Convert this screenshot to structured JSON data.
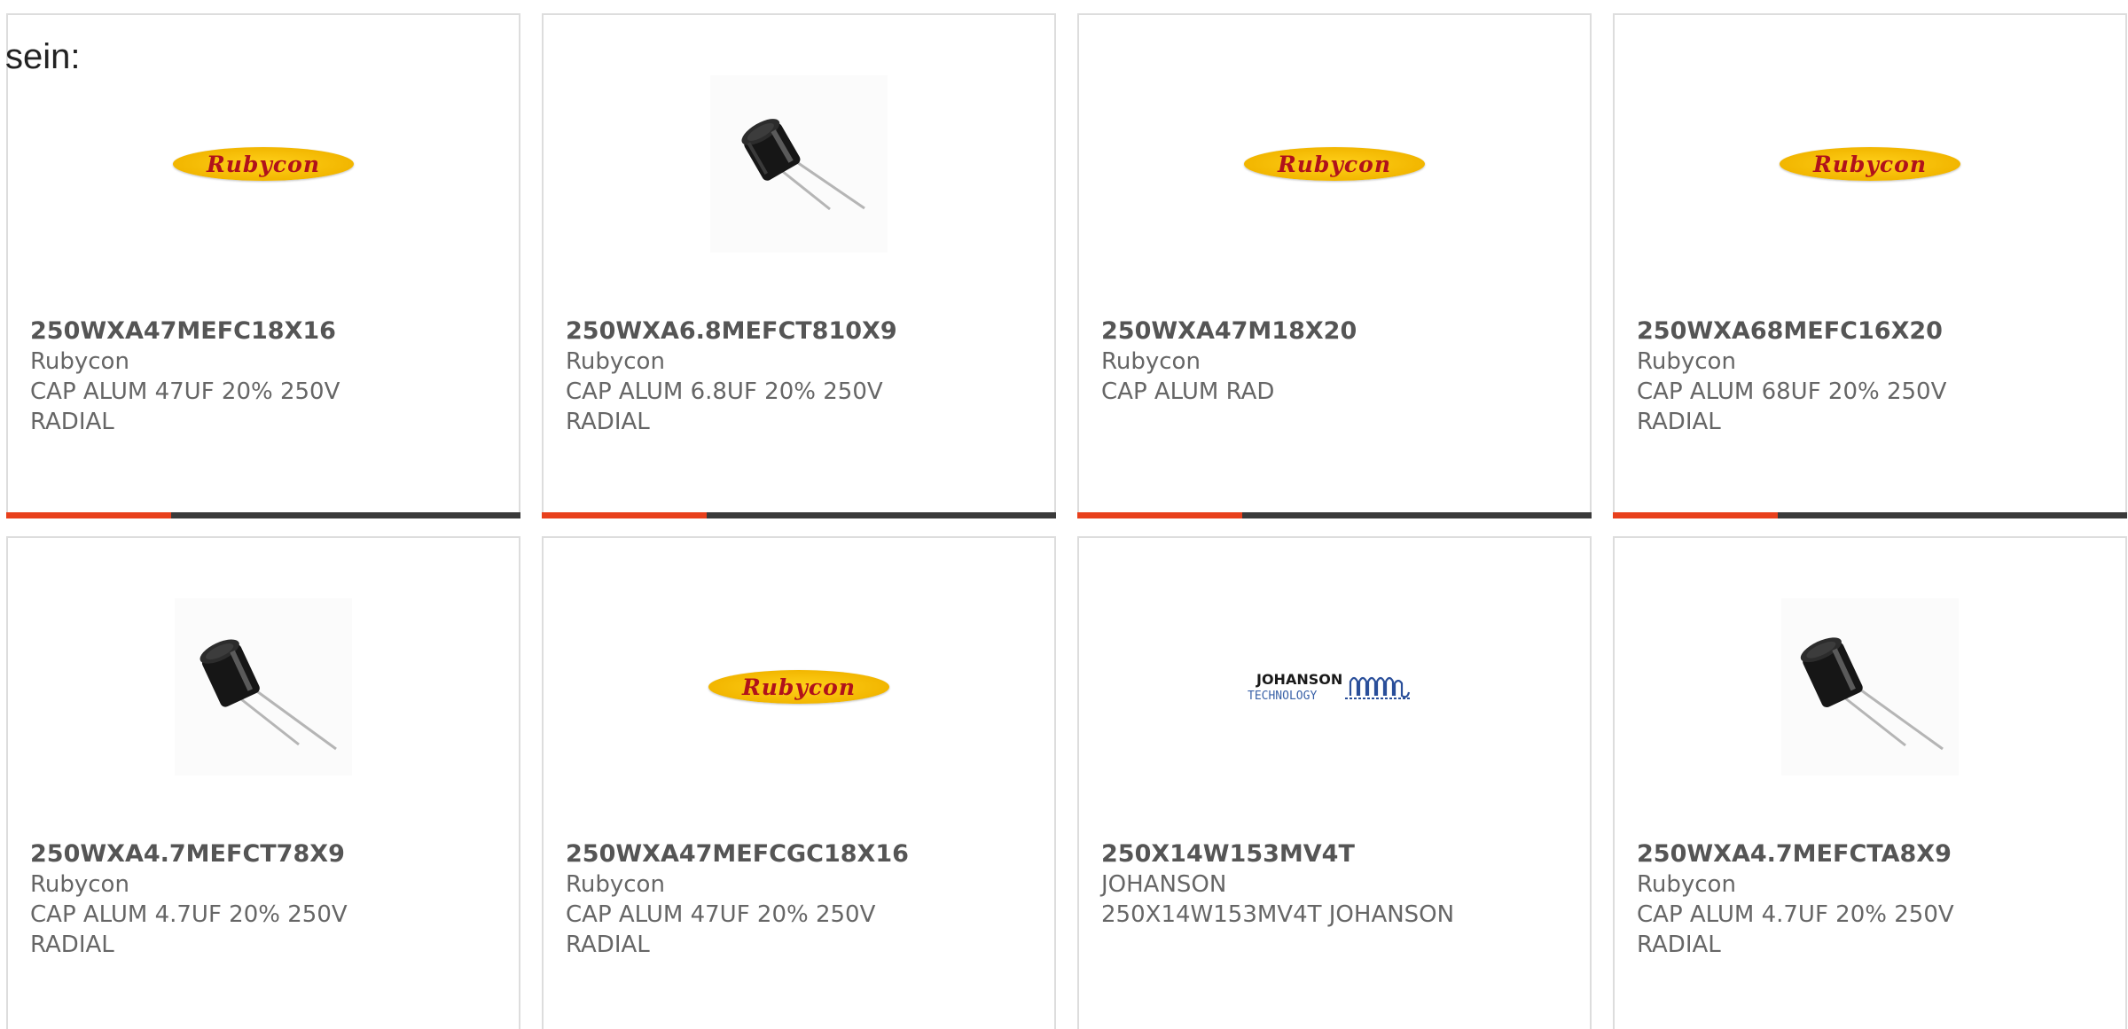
{
  "intro_text": "sein:",
  "colors": {
    "border": "#dddddd",
    "accent": "#e8401c",
    "track": "#3a3a3a",
    "rubycon_yellow": "#f2b600",
    "rubycon_red": "#b0121b"
  },
  "products": [
    {
      "part_number": "250WXA47MEFC18X16",
      "manufacturer": "Rubycon",
      "description_line1": "CAP ALUM 47UF 20% 250V",
      "description_line2": "RADIAL",
      "image": "rubycon-logo",
      "logo_text": "Rubycon",
      "progress": 0.32
    },
    {
      "part_number": "250WXA6.8MEFCT810X9",
      "manufacturer": "Rubycon",
      "description_line1": "CAP ALUM 6.8UF 20% 250V",
      "description_line2": "RADIAL",
      "image": "capacitor-photo",
      "progress": 0.32
    },
    {
      "part_number": "250WXA47M18X20",
      "manufacturer": "Rubycon",
      "description_line1": "CAP ALUM RAD",
      "description_line2": "",
      "image": "rubycon-logo",
      "logo_text": "Rubycon",
      "progress": 0.32
    },
    {
      "part_number": "250WXA68MEFC16X20",
      "manufacturer": "Rubycon",
      "description_line1": "CAP ALUM 68UF 20% 250V",
      "description_line2": "RADIAL",
      "image": "rubycon-logo",
      "logo_text": "Rubycon",
      "progress": 0.32
    },
    {
      "part_number": "250WXA4.7MEFCT78X9",
      "manufacturer": "Rubycon",
      "description_line1": "CAP ALUM 4.7UF 20% 250V",
      "description_line2": "RADIAL",
      "image": "capacitor-photo"
    },
    {
      "part_number": "250WXA47MEFCGC18X16",
      "manufacturer": "Rubycon",
      "description_line1": "CAP ALUM 47UF 20% 250V",
      "description_line2": "RADIAL",
      "image": "rubycon-logo",
      "logo_text": "Rubycon"
    },
    {
      "part_number": "250X14W153MV4T",
      "manufacturer": "JOHANSON",
      "description_line1": "250X14W153MV4T JOHANSON",
      "description_line2": "",
      "image": "johanson-logo",
      "logo_text_top": "JOHANSON",
      "logo_text_bottom": "TECHNOLOGY"
    },
    {
      "part_number": "250WXA4.7MEFCTA8X9",
      "manufacturer": "Rubycon",
      "description_line1": "CAP ALUM 4.7UF 20% 250V",
      "description_line2": "RADIAL",
      "image": "capacitor-photo"
    }
  ]
}
